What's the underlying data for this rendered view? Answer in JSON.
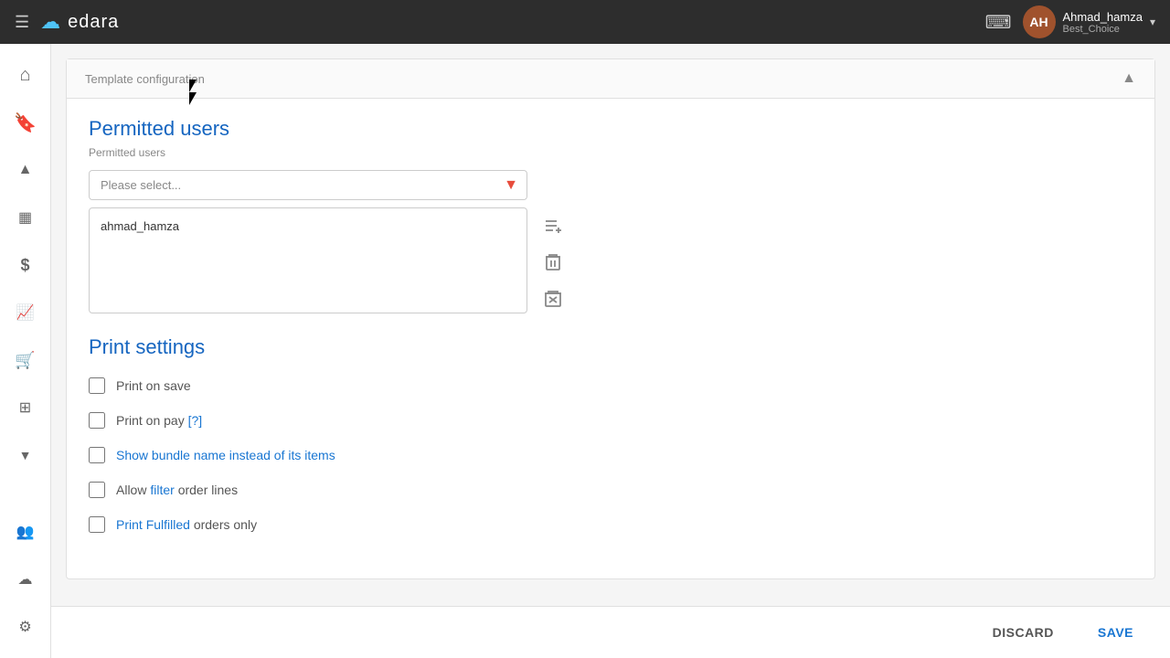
{
  "navbar": {
    "hamburger_label": "☰",
    "logo_cloud": "☁",
    "logo_text": "edara",
    "notification_icon": "🖥",
    "user": {
      "name": "Ahmad_hamza",
      "company": "Best_Choice",
      "avatar_initials": "AH"
    },
    "chevron": "▾"
  },
  "sidebar": {
    "items": [
      {
        "icon": "⌂",
        "name": "home",
        "label": "Home"
      },
      {
        "icon": "🔖",
        "name": "bookmarks",
        "label": "Bookmarks"
      },
      {
        "icon": "▲",
        "name": "collapse-up",
        "label": "Collapse"
      },
      {
        "icon": "▦",
        "name": "grid",
        "label": "Grid"
      },
      {
        "icon": "$",
        "name": "finance",
        "label": "Finance"
      },
      {
        "icon": "📈",
        "name": "analytics",
        "label": "Analytics"
      },
      {
        "icon": "🛒",
        "name": "orders",
        "label": "Orders"
      },
      {
        "icon": "⊞",
        "name": "reports",
        "label": "Reports"
      },
      {
        "icon": "▼",
        "name": "collapse-down",
        "label": "Collapse Down"
      },
      {
        "icon": "👥",
        "name": "users",
        "label": "Users"
      },
      {
        "icon": "☁",
        "name": "cloud",
        "label": "Cloud"
      },
      {
        "icon": "⚙",
        "name": "settings",
        "label": "Settings"
      }
    ]
  },
  "template_config": {
    "title": "Template configuration",
    "collapse_icon": "▲"
  },
  "permitted_users": {
    "section_title": "Permitted users",
    "section_subtitle": "Permitted users",
    "select_placeholder": "Please select...",
    "users_list": [
      "ahmad_hamza"
    ],
    "actions": {
      "add_label": "add-user-list",
      "delete_label": "delete-item",
      "clear_all_label": "clear-all"
    }
  },
  "print_settings": {
    "section_title": "Print settings",
    "checkboxes": [
      {
        "id": "print-on-save",
        "label": "Print on save",
        "checked": false,
        "color": "normal"
      },
      {
        "id": "print-on-pay",
        "label": "Print on pay",
        "checked": false,
        "has_link": true,
        "link_text": "[?]",
        "color": "normal"
      },
      {
        "id": "show-bundle-name",
        "label": "Show bundle name instead of its items",
        "checked": false,
        "color": "link"
      },
      {
        "id": "allow-filter",
        "label": "Allow filter order lines",
        "checked": false,
        "color": "link"
      },
      {
        "id": "print-fulfilled",
        "label": "Print Fulfilled orders only",
        "checked": false,
        "color": "link"
      }
    ]
  },
  "footer": {
    "discard_label": "DISCARD",
    "save_label": "SAVE"
  }
}
